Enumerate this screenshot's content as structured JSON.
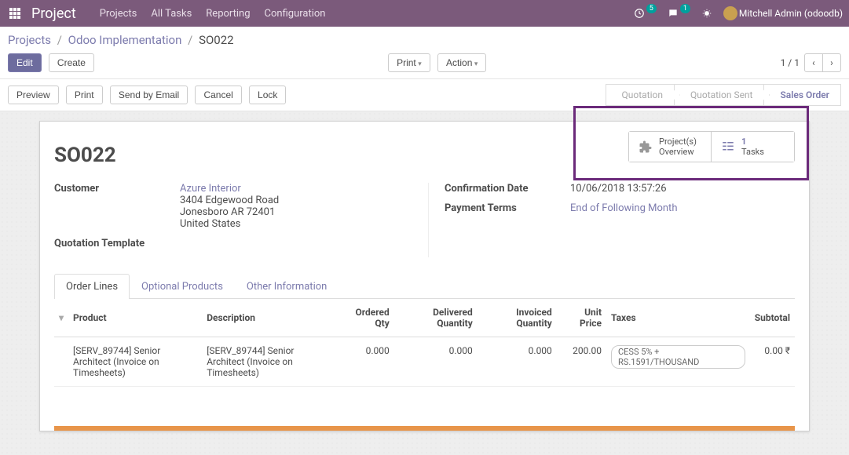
{
  "topbar": {
    "brand": "Project",
    "menus": [
      "Projects",
      "All Tasks",
      "Reporting",
      "Configuration"
    ],
    "activity_count": "5",
    "msg_count": "1",
    "user": "Mitchell Admin (odoodb)"
  },
  "breadcrumb": {
    "a": "Projects",
    "b": "Odoo Implementation",
    "c": "SO022"
  },
  "buttons": {
    "edit": "Edit",
    "create": "Create",
    "print": "Print",
    "action": "Action",
    "preview": "Preview",
    "print2": "Print",
    "send_email": "Send by Email",
    "cancel": "Cancel",
    "lock": "Lock"
  },
  "pager": "1 / 1",
  "status": {
    "quotation": "Quotation",
    "quotation_sent": "Quotation Sent",
    "sales_order": "Sales Order"
  },
  "stat": {
    "overview_line1": "Project(s)",
    "overview_line2": "Overview",
    "tasks_num": "1",
    "tasks_label": "Tasks"
  },
  "title": "SO022",
  "fields": {
    "customer_label": "Customer",
    "customer_name": "Azure Interior",
    "addr1": "3404 Edgewood Road",
    "addr2": "Jonesboro AR 72401",
    "addr3": "United States",
    "template_label": "Quotation Template",
    "conf_date_label": "Confirmation Date",
    "conf_date": "10/06/2018 13:57:26",
    "terms_label": "Payment Terms",
    "terms": "End of Following Month"
  },
  "tabs": {
    "order_lines": "Order Lines",
    "optional": "Optional Products",
    "other": "Other Information"
  },
  "table": {
    "headers": {
      "product": "Product",
      "description": "Description",
      "ordered_qty": "Ordered Qty",
      "delivered_qty": "Delivered Quantity",
      "invoiced_qty": "Invoiced Quantity",
      "unit_price": "Unit Price",
      "taxes": "Taxes",
      "subtotal": "Subtotal"
    },
    "row": {
      "product": "[SERV_89744] Senior Architect (Invoice on Timesheets)",
      "description": "[SERV_89744] Senior Architect (Invoice on Timesheets)",
      "ordered": "0.000",
      "delivered": "0.000",
      "invoiced": "0.000",
      "price": "200.00",
      "tax": "CESS 5% + RS.1591/THOUSAND",
      "subtotal": "0.00 ₹"
    }
  }
}
